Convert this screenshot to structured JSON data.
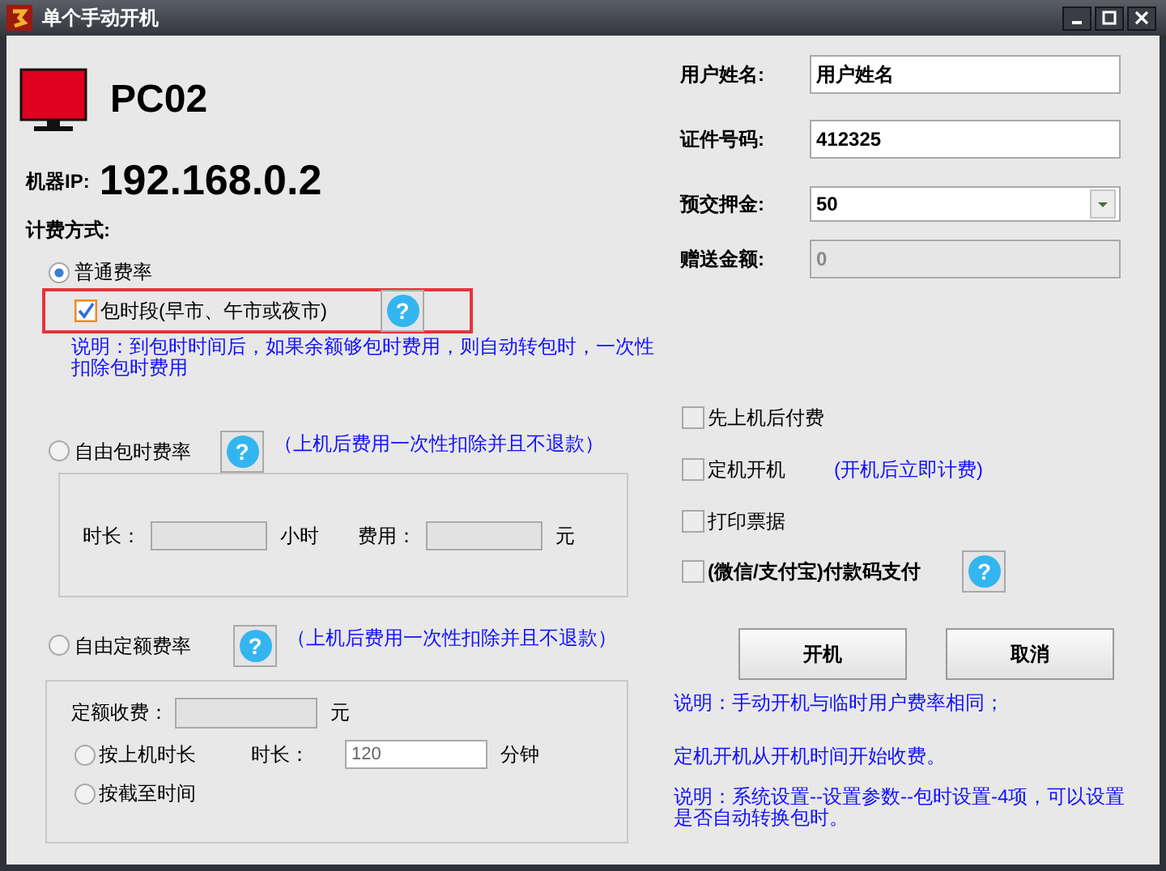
{
  "window": {
    "title": "单个手动开机"
  },
  "machine": {
    "name": "PC02",
    "ip_label": "机器IP:",
    "ip": "192.168.0.2"
  },
  "billing_label": "计费方式:",
  "rate_normal": {
    "label": "普通费率",
    "selected": true,
    "package": {
      "label": "包时段(早市、午市或夜市)",
      "checked": true,
      "highlighted": true,
      "help": "?"
    },
    "note": "说明：到包时时间后，如果余额够包时费用，则自动转包时，一次性扣除包时费用"
  },
  "rate_free_package": {
    "label": "自由包时费率",
    "selected": false,
    "help": "?",
    "note": "（上机后费用一次性扣除并且不退款）",
    "fields": [
      {
        "label": "时长：",
        "unit": "小时"
      },
      {
        "label": "费用：",
        "unit": "元"
      }
    ]
  },
  "rate_fixed": {
    "label": "自由定额费率",
    "selected": false,
    "help": "?",
    "note": "（上机后费用一次性扣除并且不退款）",
    "fee": {
      "label": "定额收费：",
      "unit": "元"
    },
    "modes": [
      {
        "label": "按上机时长",
        "selected": false
      },
      {
        "label": "按截至时间",
        "selected": false
      }
    ],
    "duration": {
      "label": "时长：",
      "value": "120",
      "unit": "分钟"
    }
  },
  "user_fields": [
    {
      "label": "用户姓名:",
      "value": "用户姓名",
      "kind": "text"
    },
    {
      "label": "证件号码:",
      "value": "412325",
      "kind": "text"
    },
    {
      "label": "预交押金:",
      "value": "50",
      "kind": "dropdown"
    },
    {
      "label": "赠送金额:",
      "value": "0",
      "kind": "disabled"
    }
  ],
  "options": [
    {
      "label": "先上机后付费",
      "checked": false
    },
    {
      "label": "定机开机",
      "checked": false,
      "note": "(开机后立即计费)"
    },
    {
      "label": "打印票据",
      "checked": false
    },
    {
      "label": "(微信/支付宝)付款码支付",
      "checked": false,
      "bold": true,
      "help": "?"
    }
  ],
  "buttons": [
    "开机",
    "取消"
  ],
  "notes": [
    "说明：手动开机与临时用户费率相同；",
    "定机开机从开机时间开始收费。",
    "说明：系统设置--设置参数--包时设置-4项，可以设置是否自动转换包时。"
  ]
}
